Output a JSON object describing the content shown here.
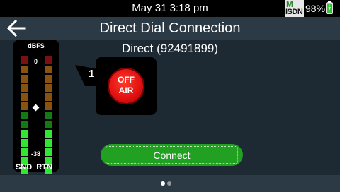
{
  "status": {
    "time": "May 31 3:18 pm",
    "network_top": "M",
    "network_bottom": "ISDN",
    "battery": "98%",
    "battery_icon": "battery-charging-icon"
  },
  "header": {
    "title": "Direct Dial Connection",
    "back_icon": "back-arrow-icon"
  },
  "connection": {
    "label": "Direct (92491899)"
  },
  "meter": {
    "unit": "dBFS",
    "top_label": "0",
    "bottom_label": "-38",
    "send_label": "SND",
    "return_label": "RTN",
    "send_level": 0.43,
    "return_level": 0.43
  },
  "line": {
    "number": "1",
    "status_line1": "OFF",
    "status_line2": "AIR",
    "status_color": "#e01010"
  },
  "actions": {
    "connect_label": "Connect",
    "connect_color": "#22a022"
  },
  "pager": {
    "pages": 2,
    "current": 1
  }
}
